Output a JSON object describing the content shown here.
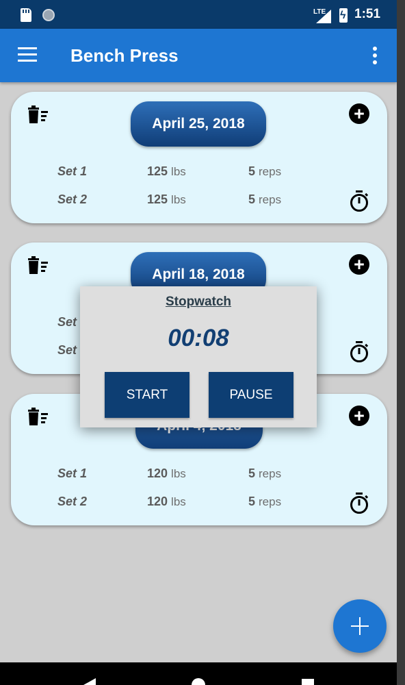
{
  "status_bar": {
    "network": "LTE",
    "time": "1:51"
  },
  "app_bar": {
    "title": "Bench Press",
    "menu_icon": "hamburger-menu-icon",
    "overflow_icon": "more-vertical-icon"
  },
  "cards": [
    {
      "date": "April 25, 2018",
      "sets": [
        {
          "label": "Set 1",
          "weight": "125",
          "weight_unit": "lbs",
          "reps": "5",
          "reps_unit": "reps"
        },
        {
          "label": "Set 2",
          "weight": "125",
          "weight_unit": "lbs",
          "reps": "5",
          "reps_unit": "reps"
        }
      ]
    },
    {
      "date": "April 18, 2018",
      "sets": [
        {
          "label": "Set"
        },
        {
          "label": "Set"
        }
      ]
    },
    {
      "date": "April 4, 2018",
      "sets": [
        {
          "label": "Set 1",
          "weight": "120",
          "weight_unit": "lbs",
          "reps": "5",
          "reps_unit": "reps"
        },
        {
          "label": "Set 2",
          "weight": "120",
          "weight_unit": "lbs",
          "reps": "5",
          "reps_unit": "reps"
        }
      ]
    }
  ],
  "dialog": {
    "title": "Stopwatch",
    "time": "00:08",
    "start_label": "START",
    "pause_label": "PAUSE"
  },
  "fab_icon": "plus-icon",
  "colors": {
    "primary": "#1e76d2",
    "status_bar": "#0a3a6a",
    "card_bg": "#e1f6fd",
    "dialog_button": "#0d3e73"
  }
}
